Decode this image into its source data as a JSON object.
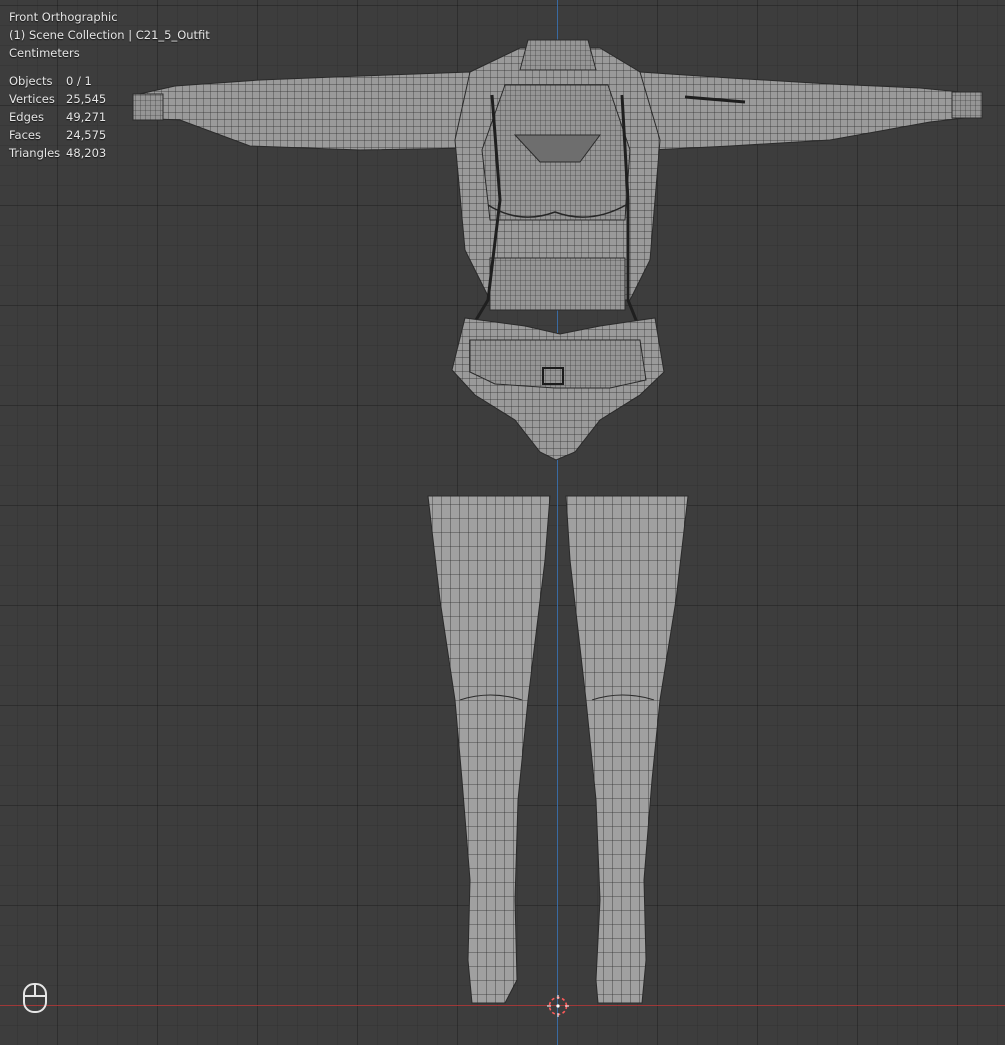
{
  "viewport": {
    "view_name": "Front Orthographic",
    "collection_label": "(1) Scene Collection | C21_5_Outfit",
    "units": "Centimeters",
    "stats": [
      {
        "label": "Objects",
        "value": "0 / 1"
      },
      {
        "label": "Vertices",
        "value": "25,545"
      },
      {
        "label": "Edges",
        "value": "49,271"
      },
      {
        "label": "Faces",
        "value": "24,575"
      },
      {
        "label": "Triangles",
        "value": "48,203"
      }
    ]
  },
  "icons": {
    "mouse": "mouse-icon",
    "cursor": "3d-cursor-icon"
  },
  "colors": {
    "background": "#3d3d3d",
    "mesh_fill": "#9c9c9c",
    "wire": "#2b2b2b",
    "x_axis": "#b33a3a",
    "z_axis": "#3b74b6"
  }
}
